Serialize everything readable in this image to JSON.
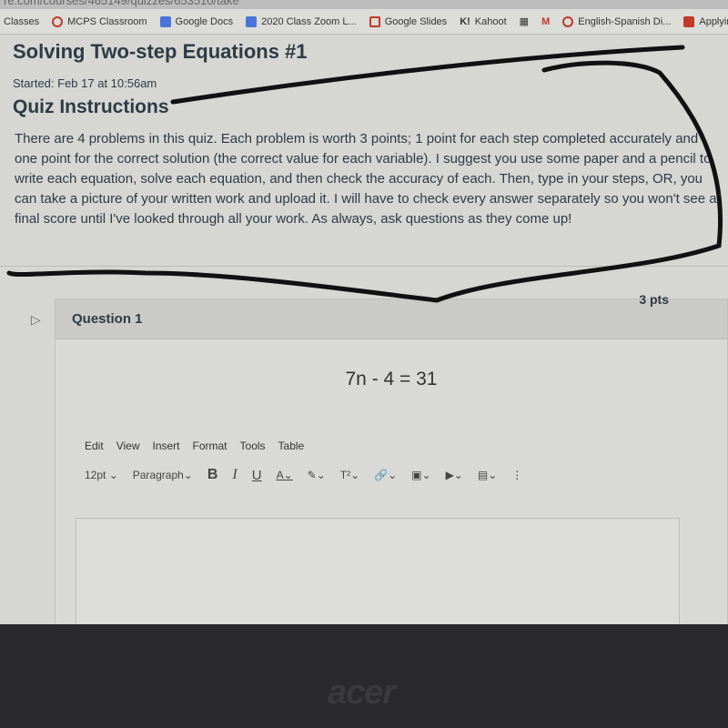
{
  "browser": {
    "url": "re.com/courses/465149/quizzes/653510/take",
    "bookmarks": [
      {
        "label": "Classes",
        "color": ""
      },
      {
        "label": "MCPS Classroom",
        "color": "#c0392b"
      },
      {
        "label": "Google Docs",
        "color": "#4a74d8"
      },
      {
        "label": "2020 Class Zoom L...",
        "color": "#4a74d8"
      },
      {
        "label": "Google Slides",
        "color": "#c0392b"
      },
      {
        "label": "Kahoot",
        "color": "#333"
      },
      {
        "label": "",
        "color": "#666"
      },
      {
        "label": "",
        "color": "#c0392b"
      },
      {
        "label": "English-Spanish Di...",
        "color": "#c0392b"
      },
      {
        "label": "Applying",
        "color": "#c0392b"
      }
    ]
  },
  "quiz": {
    "title": "Solving Two-step Equations #1",
    "started": "Started: Feb 17 at 10:56am",
    "instructions_heading": "Quiz Instructions",
    "instructions": "There are 4 problems in this quiz. Each problem is worth 3 points; 1 point for each step completed accurately and one point for the correct solution (the correct value for each variable). I suggest you use some paper and a pencil to write each equation, solve each equation, and then check the accuracy of each. Then, type in your steps, OR, you can take a picture of your written work and upload it. I will have to check every answer separately so you won't see a final score until I've looked through all your work. As always, ask questions as they come up!"
  },
  "question": {
    "name": "Question 1",
    "points": "3 pts",
    "equation": "7n - 4 = 31"
  },
  "editor": {
    "menu": [
      "Edit",
      "View",
      "Insert",
      "Format",
      "Tools",
      "Table"
    ],
    "font_size": "12pt",
    "block": "Paragraph",
    "bold": "B",
    "italic": "I",
    "underline": "U",
    "text_color": "A",
    "superscript": "T²",
    "more": "⋮"
  },
  "device": {
    "logo": "acer"
  }
}
